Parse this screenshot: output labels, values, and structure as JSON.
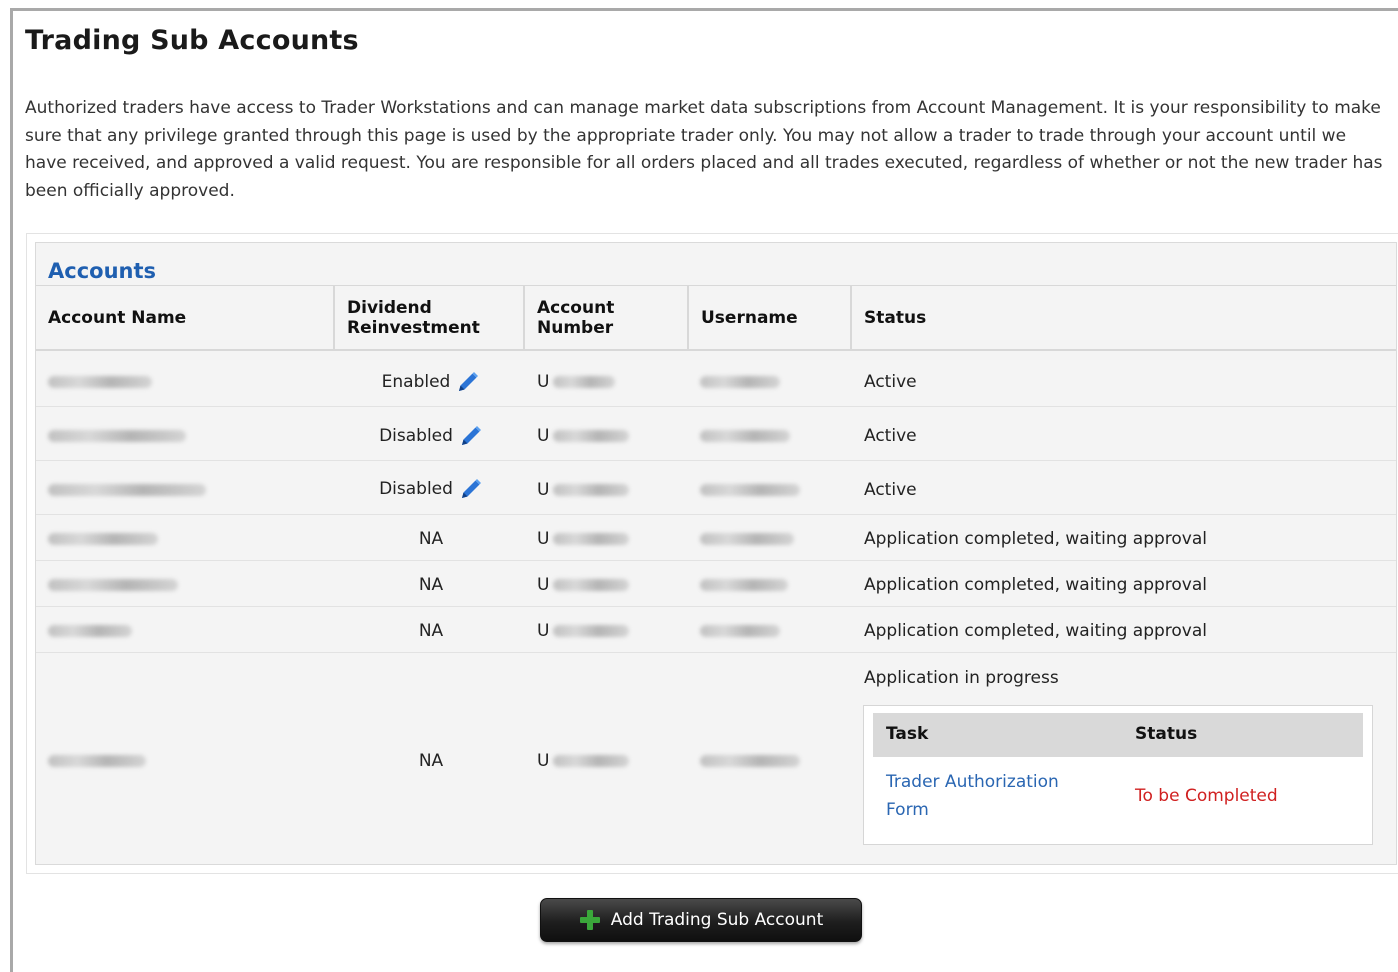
{
  "page": {
    "title": "Trading Sub Accounts",
    "intro": "Authorized traders have access to Trader Workstations and can manage market data subscriptions from Account Management. It is your responsibility to make sure that any privilege granted through this page is used by the appropriate trader only. You may not allow a trader to trade through your account until we have received, and approved a valid request. You are responsible for all orders placed and all trades executed, regardless of whether or not the new trader has been officially approved."
  },
  "accounts": {
    "title": "Accounts",
    "columns": {
      "account_name": "Account Name",
      "dividend_line1": "Dividend",
      "dividend_line2": "Reinvestment",
      "account_number_line1": "Account",
      "account_number_line2": "Number",
      "username": "Username",
      "status": "Status"
    },
    "rows": [
      {
        "dividend": "Enabled",
        "account_prefix": "U",
        "status": "Active",
        "editable": true
      },
      {
        "dividend": "Disabled",
        "account_prefix": "U",
        "status": "Active",
        "editable": true
      },
      {
        "dividend": "Disabled",
        "account_prefix": "U",
        "status": "Active",
        "editable": true
      },
      {
        "dividend": "NA",
        "account_prefix": "U",
        "status": "Application completed, waiting approval",
        "editable": false
      },
      {
        "dividend": "NA",
        "account_prefix": "U",
        "status": "Application completed, waiting approval",
        "editable": false
      },
      {
        "dividend": "NA",
        "account_prefix": "U",
        "status": "Application completed, waiting approval",
        "editable": false
      },
      {
        "dividend": "NA",
        "account_prefix": "U",
        "status": "Application in progress",
        "editable": false
      }
    ],
    "subtask": {
      "task_header": "Task",
      "status_header": "Status",
      "task_link_line1": "Trader Authorization",
      "task_link_line2": "Form",
      "task_status": "To be Completed"
    }
  },
  "actions": {
    "add_label": "Add Trading Sub Account"
  },
  "colors": {
    "accent_blue": "#1f5fb0",
    "link_blue": "#2a66b2",
    "status_red": "#d02020",
    "plus_green": "#3aa83a"
  },
  "icons": {
    "edit": "pencil-icon",
    "add": "plus-icon"
  }
}
